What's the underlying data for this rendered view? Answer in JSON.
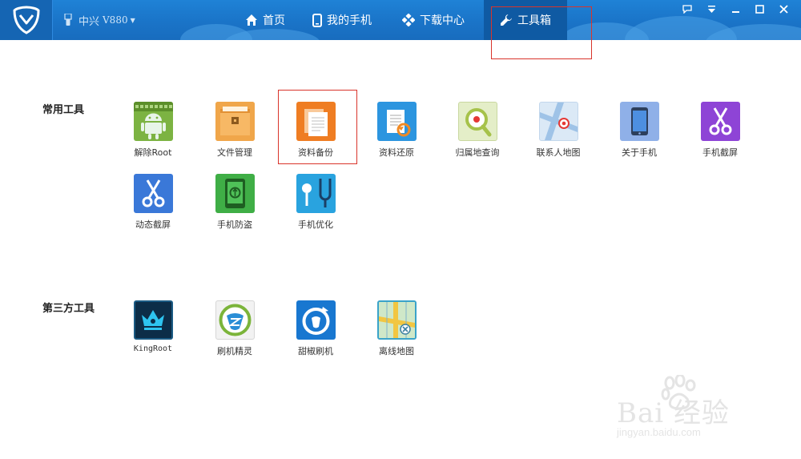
{
  "header": {
    "device_name": "中兴",
    "device_model": "V880",
    "tabs": [
      {
        "label": "首页",
        "icon": "home-icon"
      },
      {
        "label": "我的手机",
        "icon": "phone-icon"
      },
      {
        "label": "下载中心",
        "icon": "download-center-icon"
      },
      {
        "label": "工具箱",
        "icon": "wrench-icon",
        "active": true
      }
    ],
    "window_controls": [
      "feedback-icon",
      "menu-icon",
      "minimize-icon",
      "maximize-icon",
      "close-icon"
    ]
  },
  "sections": [
    {
      "title": "常用工具",
      "items": [
        {
          "label": "解除Root",
          "icon": "android-unroot-icon"
        },
        {
          "label": "文件管理",
          "icon": "file-manager-icon"
        },
        {
          "label": "资料备份",
          "icon": "data-backup-icon"
        },
        {
          "label": "资料还原",
          "icon": "data-restore-icon"
        },
        {
          "label": "归属地查询",
          "icon": "location-lookup-icon"
        },
        {
          "label": "联系人地图",
          "icon": "contact-map-icon"
        },
        {
          "label": "关于手机",
          "icon": "about-phone-icon"
        },
        {
          "label": "手机截屏",
          "icon": "phone-screenshot-icon"
        },
        {
          "label": "动态截屏",
          "icon": "dynamic-screenshot-icon"
        },
        {
          "label": "手机防盗",
          "icon": "anti-theft-icon"
        },
        {
          "label": "手机优化",
          "icon": "phone-optimize-icon"
        }
      ]
    },
    {
      "title": "第三方工具",
      "items": [
        {
          "label": "KingRoot",
          "icon": "kingroot-icon"
        },
        {
          "label": "刷机精灵",
          "icon": "shuaji-jingling-icon"
        },
        {
          "label": "甜椒刷机",
          "icon": "tianjiao-shuaji-icon"
        },
        {
          "label": "离线地图",
          "icon": "offline-map-icon"
        }
      ]
    }
  ],
  "watermark": {
    "brand": "Bai 经验",
    "url": "jingyan.baidu.com"
  },
  "colors": {
    "titlebar": "#1a74c8",
    "active_tab": "#0f5aa3",
    "highlight": "#d9342b"
  }
}
